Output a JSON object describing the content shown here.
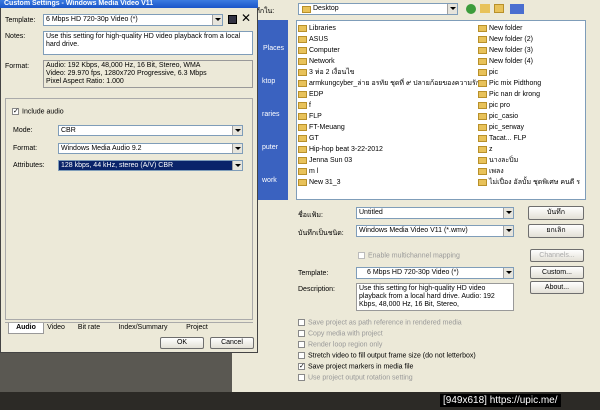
{
  "dialog": {
    "title": "Custom Settings - Windows Media Video V11",
    "template_label": "Template:",
    "template_value": "6 Mbps HD 720-30p Video (*)",
    "notes_label": "Notes:",
    "notes_value": "Use this setting for high-quality HD video playback from a local hard drive.",
    "format_label": "Format:",
    "format_lines": [
      "Audio: 192 Kbps, 48,000 Hz, 16 Bit, Stereo, WMA",
      "Video: 29.970 fps, 1280x720 Progressive, 6.3 Mbps",
      "Pixel Aspect Ratio: 1.000"
    ],
    "include_audio": "Include audio",
    "mode_label": "Mode:",
    "mode_value": "CBR",
    "audio_format_label": "Format:",
    "audio_format_value": "Windows Media Audio 9.2",
    "attributes_label": "Attributes:",
    "attributes_value": "128 kbps, 44 kHz, stereo (A/V) CBR",
    "tabs": [
      "Audio",
      "Video",
      "Bit rate",
      "Index/Summary",
      "Project"
    ],
    "ok": "OK",
    "cancel": "Cancel"
  },
  "places": {
    "items": [
      "Places",
      "ktop",
      "raries",
      "puter",
      "work"
    ]
  },
  "save_dialog": {
    "save_in_label": "บันทึกใน:",
    "location": "Desktop",
    "files_left": [
      "Libraries",
      "ASUS",
      "Computer",
      "Network",
      "3 ห่อ 2 เงื่อนไข",
      "armkungcyber_ล่าย อรทัย ชุดที่ ๙ ปลายก้อยของความรัก",
      "EDP",
      "f",
      "FLP",
      "FT-Meuang",
      "GT",
      "Hip-hop beat 3-22-2012",
      "Jenna Sun 03",
      "m l",
      "New 31_3"
    ],
    "files_right": [
      "New folder",
      "New folder (2)",
      "New folder (3)",
      "New folder (4)",
      "pic",
      "Pic mix Pidthong",
      "Pic nan dr krong",
      "pic pro",
      "pic_casio",
      "pic_serway",
      "Tacat... FLP",
      "z",
      "นางละปิ่ม",
      "เพลง",
      "ไม่เปื่อง อัลบั้ม ชุดพิเศษ คนดี ร"
    ],
    "filename_label": "ชื่อแฟ้ม:",
    "filename_value": "Untitled",
    "save_as_type_label": "บันทึกเป็นชนิด:",
    "save_as_type_value": "Windows Media Video V11 (*.wmv)",
    "save_button": "บันทึก",
    "cancel_button": "ยกเลิก",
    "multichannel": "Enable multichannel mapping",
    "channels": "Channels...",
    "template_label": "Template:",
    "template_value": "6 Mbps HD 720-30p Video (*)",
    "custom": "Custom...",
    "description_label": "Description:",
    "description_value": "Use this setting for high-quality HD video playback from a local hard drive. Audio: 192 Kbps, 48,000 Hz, 16 Bit, Stereo,",
    "about": "About...",
    "options": [
      {
        "label": "Save project as path reference in rendered media",
        "checked": false,
        "enabled": false
      },
      {
        "label": "Copy media with project",
        "checked": false,
        "enabled": false
      },
      {
        "label": "Render loop region only",
        "checked": false,
        "enabled": false
      },
      {
        "label": "Stretch video to fill output frame size (do not letterbox)",
        "checked": false,
        "enabled": true
      },
      {
        "label": "Save project markers in media file",
        "checked": true,
        "enabled": true
      },
      {
        "label": "Use project output rotation setting",
        "checked": false,
        "enabled": false
      }
    ]
  },
  "watermark": "[949x618] https://upic.me/"
}
